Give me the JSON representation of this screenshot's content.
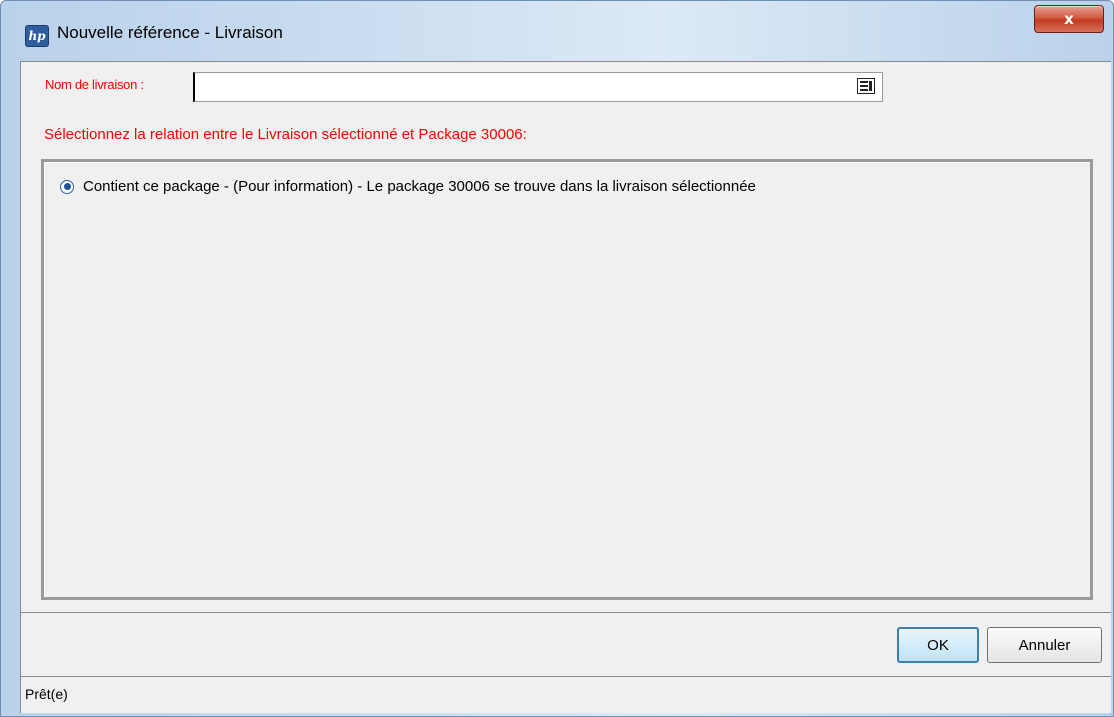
{
  "window": {
    "title": "Nouvelle référence - Livraison",
    "app_icon_text": "hp",
    "close_label": "x"
  },
  "form": {
    "name_label": "Nom de livraison :",
    "name_value": "",
    "relation_prompt": "Sélectionnez la relation entre le Livraison sélectionné et Package 30006:",
    "options": [
      {
        "label": "Contient ce package - (Pour information) - Le package 30006 se trouve dans la livraison sélectionnée",
        "selected": true
      }
    ]
  },
  "buttons": {
    "ok": "OK",
    "cancel": "Annuler"
  },
  "status": {
    "text": "Prêt(e)"
  },
  "colors": {
    "label_red": "#ff0000",
    "title_bar": "#c9dcf0",
    "close_red": "#c33a23"
  }
}
